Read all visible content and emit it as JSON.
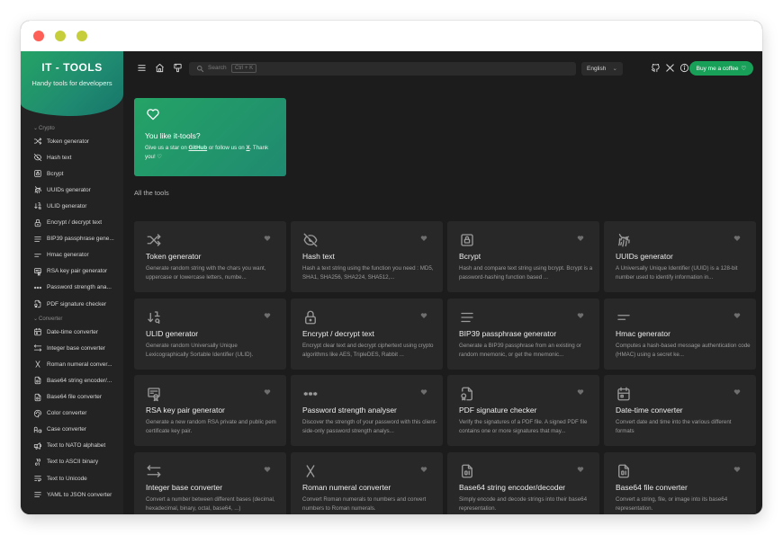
{
  "app": {
    "title": "IT - TOOLS",
    "subtitle": "Handy tools for developers"
  },
  "colors": {
    "accent": "#18a058",
    "background": "#1c1c1c",
    "sidebar": "#232323",
    "card": "#282828"
  },
  "sidebar": {
    "categories": [
      {
        "label": "Crypto",
        "items": [
          {
            "label": "Token generator",
            "icon": "shuffle-icon"
          },
          {
            "label": "Hash text",
            "icon": "eye-off-icon"
          },
          {
            "label": "Bcrypt",
            "icon": "lock-square-icon"
          },
          {
            "label": "UUIDs generator",
            "icon": "fingerprint-icon"
          },
          {
            "label": "ULID generator",
            "icon": "sort-numeric-icon"
          },
          {
            "label": "Encrypt / decrypt text",
            "icon": "lock-icon"
          },
          {
            "label": "BIP39 passphrase gene...",
            "icon": "align-justified-icon"
          },
          {
            "label": "Hmac generator",
            "icon": "short-text-icon"
          },
          {
            "label": "RSA key pair generator",
            "icon": "certificate-icon"
          },
          {
            "label": "Password strength ana...",
            "icon": "password-icon"
          },
          {
            "label": "PDF signature checker",
            "icon": "file-cert-icon"
          }
        ]
      },
      {
        "label": "Converter",
        "items": [
          {
            "label": "Date-time converter",
            "icon": "calendar-icon"
          },
          {
            "label": "Integer base converter",
            "icon": "arrows-left-right-icon"
          },
          {
            "label": "Roman numeral conver...",
            "icon": "letter-x-icon"
          },
          {
            "label": "Base64 string encoder/...",
            "icon": "file-digit-icon"
          },
          {
            "label": "Base64 file converter",
            "icon": "file-digit-icon"
          },
          {
            "label": "Color converter",
            "icon": "palette-icon"
          },
          {
            "label": "Case converter",
            "icon": "letter-case-icon"
          },
          {
            "label": "Text to NATO alphabet",
            "icon": "speakerphone-icon"
          },
          {
            "label": "Text to ASCII binary",
            "icon": "binary-icon"
          },
          {
            "label": "Text to Unicode",
            "icon": "text-wrap-icon"
          },
          {
            "label": "YAML to JSON converter",
            "icon": "align-justified-icon"
          }
        ]
      }
    ]
  },
  "topbar": {
    "search_placeholder": "Search",
    "search_shortcut": "Ctrl + K",
    "language": "English",
    "coffee_label": "Buy me a coffee"
  },
  "promo": {
    "title": "You like it-tools?",
    "text_before": "Give us a star on ",
    "github": "GitHub",
    "text_middle": " or follow us on ",
    "x": "X",
    "text_after": ". Thank you! ♡"
  },
  "tools_section_title": "All the tools",
  "tools": [
    {
      "title": "Token generator",
      "desc": "Generate random string with the chars you want, uppercase or lowercase letters, numbe...",
      "icon": "shuffle-icon"
    },
    {
      "title": "Hash text",
      "desc": "Hash a text string using the function you need : MD5, SHA1, SHA256, SHA224, SHA512,...",
      "icon": "eye-off-icon"
    },
    {
      "title": "Bcrypt",
      "desc": "Hash and compare text string using bcrypt. Bcrypt is a password-hashing function based ...",
      "icon": "lock-square-icon"
    },
    {
      "title": "UUIDs generator",
      "desc": "A Universally Unique Identifier (UUID) is a 128-bit number used to identify information in...",
      "icon": "fingerprint-icon"
    },
    {
      "title": "ULID generator",
      "desc": "Generate random Universally Unique Lexicographically Sortable Identifier (ULID).",
      "icon": "sort-numeric-icon"
    },
    {
      "title": "Encrypt / decrypt text",
      "desc": "Encrypt clear text and decrypt ciphertext using crypto algorithms like AES, TripleDES, Rabbit ...",
      "icon": "lock-icon"
    },
    {
      "title": "BIP39 passphrase generator",
      "desc": "Generate a BIP39 passphrase from an existing or random mnemonic, or get the mnemonic...",
      "icon": "align-justified-icon"
    },
    {
      "title": "Hmac generator",
      "desc": "Computes a hash-based message authentication code (HMAC) using a secret ke...",
      "icon": "short-text-icon"
    },
    {
      "title": "RSA key pair generator",
      "desc": "Generate a new random RSA private and public pem certificate key pair.",
      "icon": "certificate-icon"
    },
    {
      "title": "Password strength analyser",
      "desc": "Discover the strength of your password with this client-side-only password strength analys...",
      "icon": "password-icon"
    },
    {
      "title": "PDF signature checker",
      "desc": "Verify the signatures of a PDF file. A signed PDF file contains one or more signatures that may...",
      "icon": "file-cert-icon"
    },
    {
      "title": "Date-time converter",
      "desc": "Convert date and time into the various different formats",
      "icon": "calendar-icon"
    },
    {
      "title": "Integer base converter",
      "desc": "Convert a number between different bases (decimal, hexadecimal, binary, octal, base64, ...)",
      "icon": "arrows-left-right-icon"
    },
    {
      "title": "Roman numeral converter",
      "desc": "Convert Roman numerals to numbers and convert numbers to Roman numerals.",
      "icon": "letter-x-icon"
    },
    {
      "title": "Base64 string encoder/decoder",
      "desc": "Simply encode and decode strings into their base64 representation.",
      "icon": "file-digit-icon"
    },
    {
      "title": "Base64 file converter",
      "desc": "Convert a string, file, or image into its base64 representation.",
      "icon": "file-digit-icon"
    }
  ]
}
